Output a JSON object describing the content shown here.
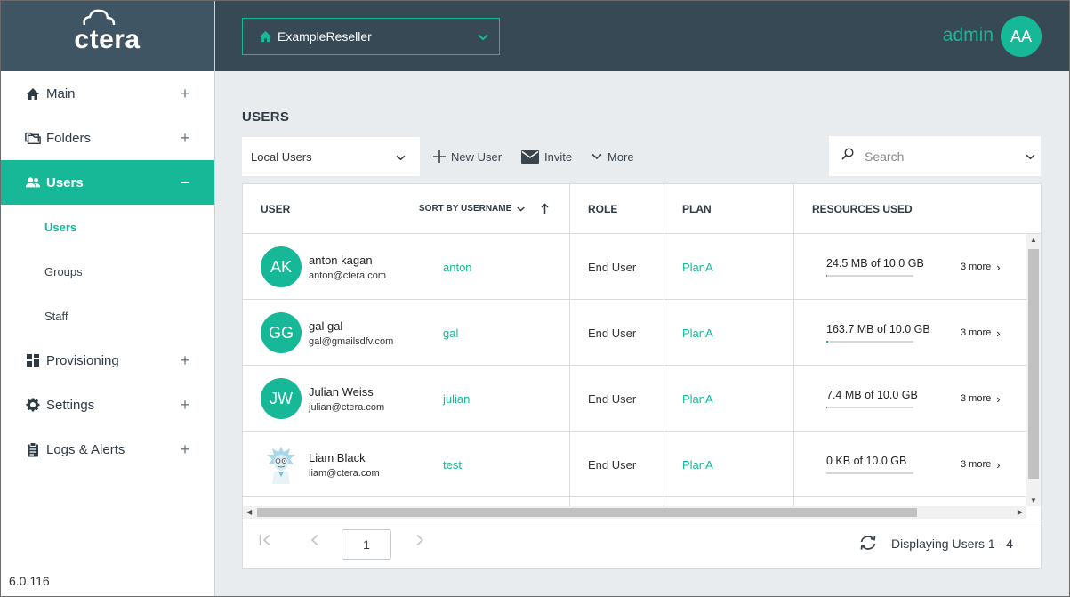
{
  "app": {
    "logo_text": "ctera",
    "version": "6.0.116"
  },
  "sidebar": {
    "items": [
      {
        "label": "Main",
        "toggle": "+"
      },
      {
        "label": "Folders",
        "toggle": "+"
      },
      {
        "label": "Users",
        "toggle": "−",
        "active": true
      },
      {
        "label": "Provisioning",
        "toggle": "+"
      },
      {
        "label": "Settings",
        "toggle": "+"
      },
      {
        "label": "Logs & Alerts",
        "toggle": "+"
      }
    ],
    "subitems": [
      {
        "label": "Users",
        "active": true
      },
      {
        "label": "Groups"
      },
      {
        "label": "Staff"
      }
    ]
  },
  "header": {
    "reseller": "ExampleReseller",
    "admin_name": "admin",
    "admin_initials": "AA"
  },
  "main": {
    "title": "USERS",
    "filter_value": "Local Users",
    "toolbar": {
      "new_user": "New User",
      "invite": "Invite",
      "more": "More"
    },
    "search_placeholder": "Search"
  },
  "table": {
    "headers": {
      "user": "USER",
      "sort_by": "SORT BY USERNAME",
      "role": "ROLE",
      "plan": "PLAN",
      "resources": "RESOURCES USED"
    },
    "rows": [
      {
        "initials": "AK",
        "name": "anton kagan",
        "email": "anton@ctera.com",
        "username": "anton",
        "role": "End User",
        "plan": "PlanA",
        "resources": "24.5 MB of 10.0 GB",
        "usage_fraction": 0.002,
        "more": "3 more"
      },
      {
        "initials": "GG",
        "name": "gal gal",
        "email": "gal@gmailsdfv.com",
        "username": "gal",
        "role": "End User",
        "plan": "PlanA",
        "resources": "163.7 MB of 10.0 GB",
        "usage_fraction": 0.016,
        "more": "3 more"
      },
      {
        "initials": "JW",
        "name": "Julian Weiss",
        "email": "julian@ctera.com",
        "username": "julian",
        "role": "End User",
        "plan": "PlanA",
        "resources": "7.4 MB of 10.0 GB",
        "usage_fraction": 0.001,
        "more": "3 more"
      },
      {
        "initials": "",
        "name": "Liam Black",
        "email": "liam@ctera.com",
        "username": "test",
        "role": "End User",
        "plan": "PlanA",
        "resources": "0 KB of 10.0 GB",
        "usage_fraction": 0,
        "more": "3 more",
        "has_photo": true
      }
    ]
  },
  "pager": {
    "page": "1",
    "display_text": "Displaying Users 1 - 4"
  },
  "colors": {
    "accent": "#17b897",
    "header_bg": "#374955",
    "logo_bg": "#3f5563"
  }
}
